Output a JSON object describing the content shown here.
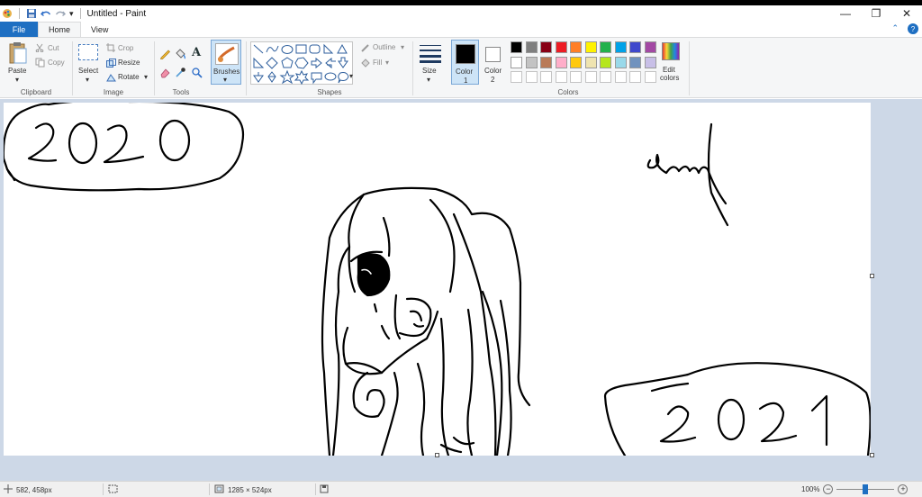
{
  "window": {
    "title": "Untitled - Paint",
    "controls": {
      "minimize": "—",
      "maximize": "❐",
      "close": "✕"
    }
  },
  "qat": {
    "dropdown": "▾"
  },
  "tabs": {
    "file": "File",
    "home": "Home",
    "view": "View",
    "collapse": "⌃",
    "help": "?"
  },
  "ribbon": {
    "clipboard": {
      "label": "Clipboard",
      "paste": "Paste",
      "cut": "Cut",
      "copy": "Copy"
    },
    "image": {
      "label": "Image",
      "select": "Select",
      "crop": "Crop",
      "resize": "Resize",
      "rotate": "Rotate"
    },
    "tools": {
      "label": "Tools"
    },
    "brushes": {
      "label": "Brushes"
    },
    "shapes": {
      "label": "Shapes",
      "outline": "Outline",
      "fill": "Fill"
    },
    "size": {
      "label": "Size"
    },
    "color1": {
      "label": "Color",
      "num": "1",
      "value": "#000000"
    },
    "color2": {
      "label": "Color",
      "num": "2",
      "value": "#ffffff"
    },
    "colors": {
      "label": "Colors",
      "edit_line1": "Edit",
      "edit_line2": "colors",
      "row1": [
        "#000000",
        "#7f7f7f",
        "#880015",
        "#ed1c24",
        "#ff7f27",
        "#fff200",
        "#22b14c",
        "#00a2e8",
        "#3f48cc",
        "#a349a4"
      ],
      "row2": [
        "#ffffff",
        "#c3c3c3",
        "#b97a57",
        "#ffaec9",
        "#ffc90e",
        "#efe4b0",
        "#b5e61d",
        "#99d9ea",
        "#7092be",
        "#c8bfe7"
      ],
      "row3": [
        "#ffffff",
        "#ffffff",
        "#ffffff",
        "#ffffff",
        "#ffffff",
        "#ffffff",
        "#ffffff",
        "#ffffff",
        "#ffffff",
        "#ffffff"
      ]
    }
  },
  "canvas_text": {
    "year_left": "2020",
    "year_right": "2021"
  },
  "status": {
    "cursor_pos": "582, 458px",
    "image_size": "1285 × 524px",
    "zoom": "100%",
    "zoom_level": 1.0
  }
}
